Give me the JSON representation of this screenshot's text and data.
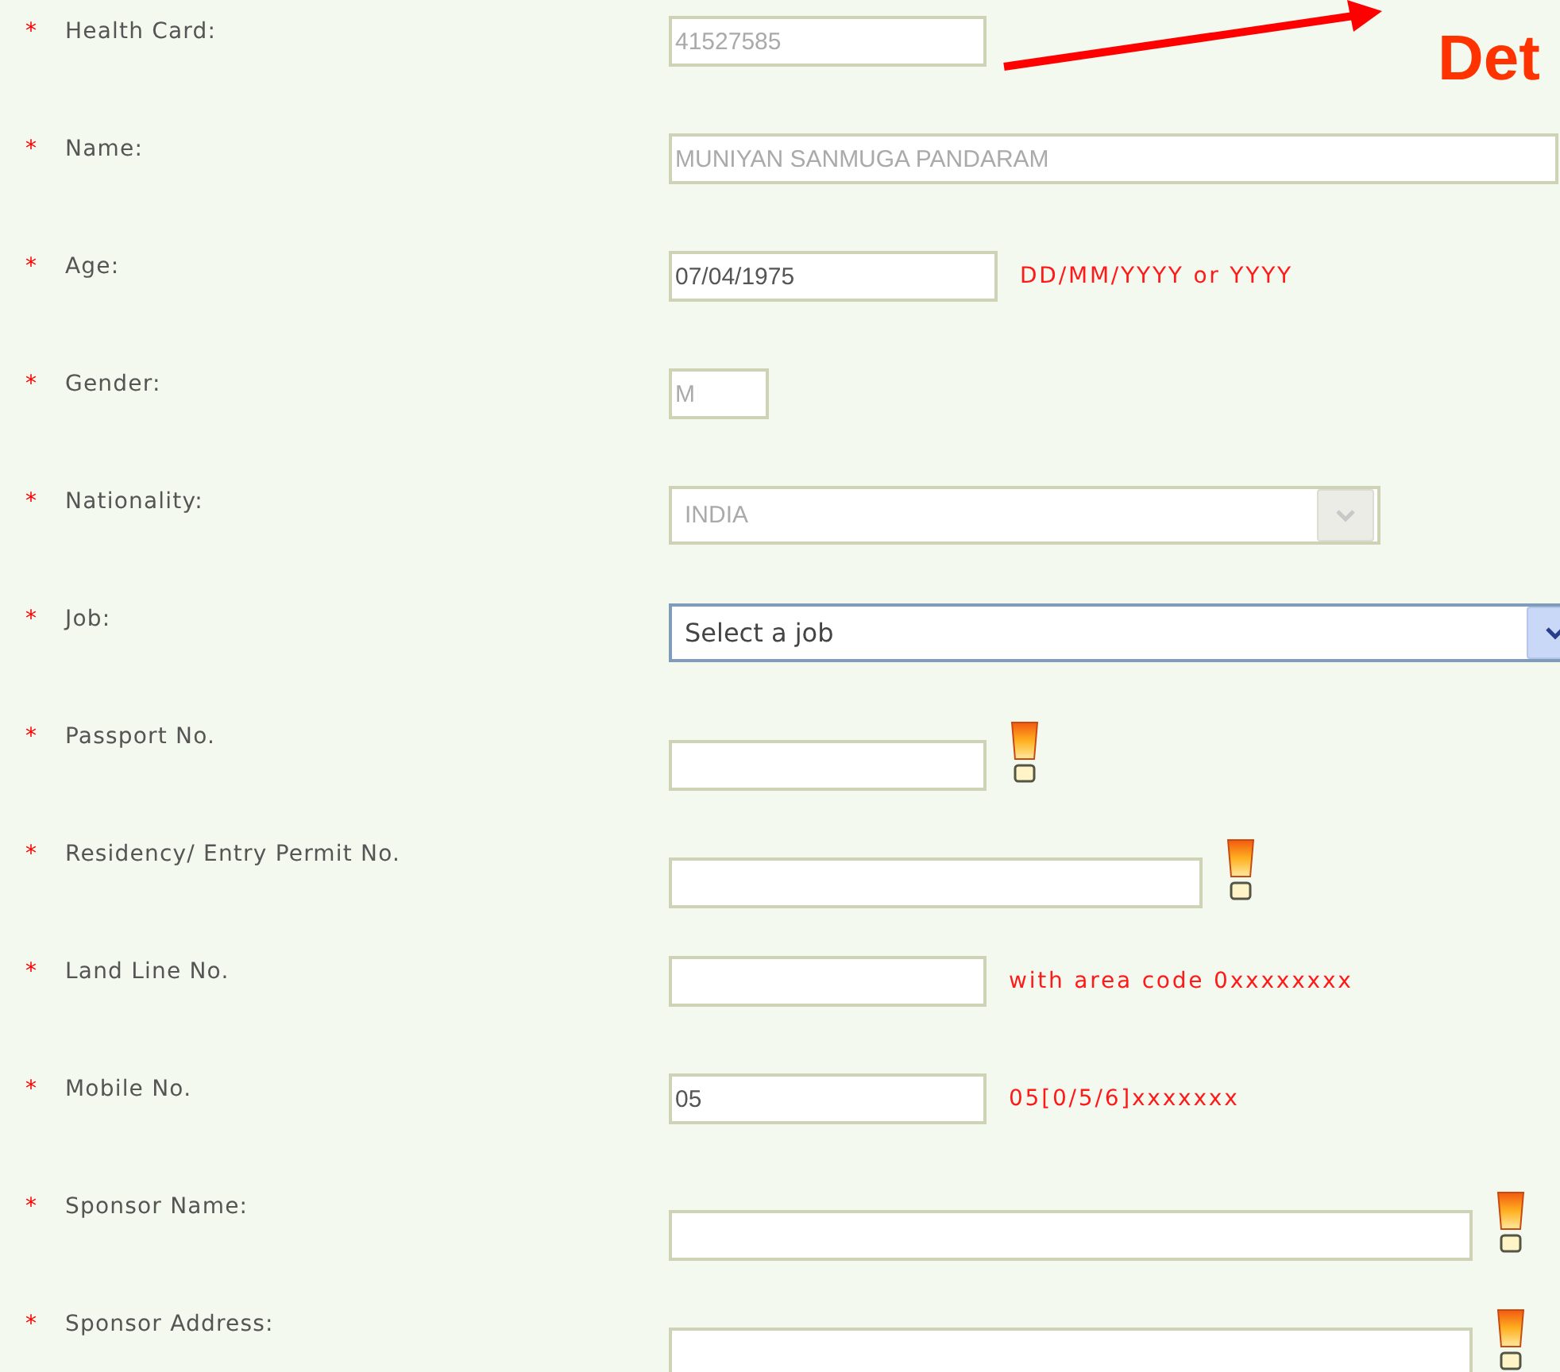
{
  "callout": {
    "text": "Det"
  },
  "fields": [
    {
      "label": "Health Card:",
      "marker": "*",
      "kind": "text",
      "value": "41527585",
      "disabled": true
    },
    {
      "label": "Name:",
      "marker": "*",
      "kind": "text",
      "value": "MUNIYAN SANMUGA PANDARAM",
      "disabled": true
    },
    {
      "label": "Age:",
      "marker": "*",
      "kind": "text",
      "value": "07/04/1975",
      "disabled": false,
      "hint": "DD/MM/YYYY or YYYY"
    },
    {
      "label": "Gender:",
      "marker": "*",
      "kind": "text",
      "value": "M",
      "disabled": true
    },
    {
      "label": "Nationality:",
      "marker": "*",
      "kind": "select",
      "value": "INDIA",
      "disabled": true
    },
    {
      "label": "Job:",
      "marker": "*",
      "kind": "select",
      "value": "Select a job",
      "disabled": false
    },
    {
      "label": "Passport No.",
      "marker": "*",
      "kind": "text",
      "info": true
    },
    {
      "label": "Residency/ Entry Permit No.",
      "marker": "*",
      "kind": "text",
      "info": true
    },
    {
      "label": "Land Line No.",
      "marker": "*",
      "kind": "text",
      "hint": "with area code 0xxxxxxxx"
    },
    {
      "label": "Mobile No.",
      "marker": "*",
      "kind": "text",
      "value": "05",
      "disabled": false,
      "hint": "05[0/5/6]xxxxxxx"
    },
    {
      "label": "Sponsor Name:",
      "marker": "*",
      "kind": "text",
      "info": true
    },
    {
      "label": "Sponsor Address:",
      "marker": "*",
      "kind": "text",
      "info": true
    }
  ]
}
